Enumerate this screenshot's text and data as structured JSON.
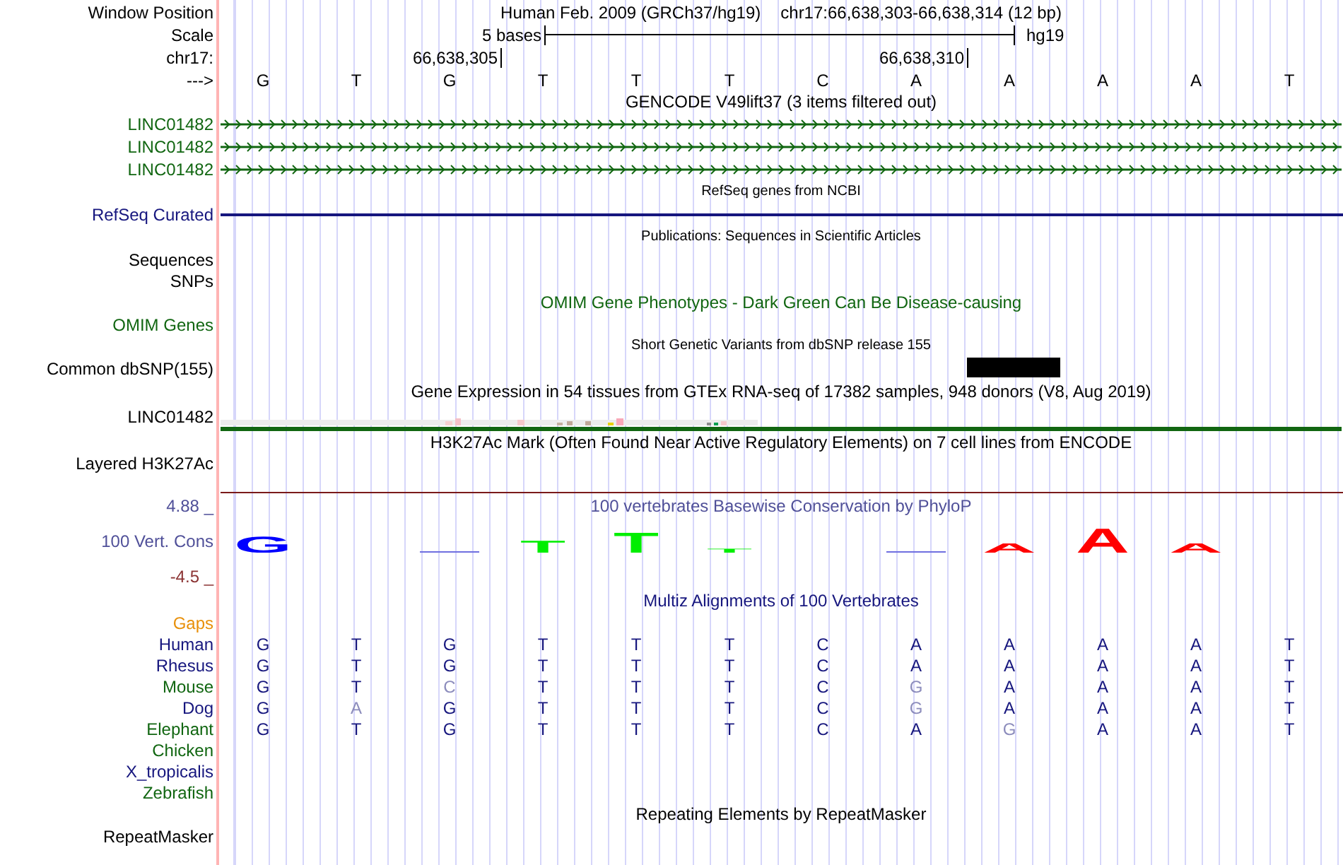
{
  "tracks": [
    {
      "kind": "position",
      "label": "Window Position",
      "text": "Human Feb. 2009 (GRCh37/hg19)",
      "range": "chr17:66,638,303-66,638,314 (12 bp)"
    },
    {
      "kind": "scale",
      "label": "Scale",
      "scale_text": "5 bases",
      "assembly": "hg19"
    },
    {
      "kind": "coords",
      "label": "chr17:",
      "ticks": [
        "66,638,305",
        "66,638,310"
      ]
    },
    {
      "kind": "sequence",
      "label": "--->",
      "bases": [
        "G",
        "T",
        "G",
        "T",
        "T",
        "T",
        "C",
        "A",
        "A",
        "A",
        "A",
        "T"
      ]
    },
    {
      "kind": "title",
      "text": "GENCODE V49lift37 (3 items filtered out)",
      "color": "#000000"
    },
    {
      "kind": "gene",
      "label": "LINC01482",
      "color": "#116611"
    },
    {
      "kind": "gene",
      "label": "LINC01482",
      "color": "#116611"
    },
    {
      "kind": "gene",
      "label": "LINC01482",
      "color": "#116611"
    },
    {
      "kind": "subtitle",
      "text": "RefSeq genes from NCBI"
    },
    {
      "kind": "line",
      "label": "RefSeq Curated",
      "color": "#16167e"
    },
    {
      "kind": "subtitle",
      "text": "Publications: Sequences in Scientific Articles"
    },
    {
      "kind": "empty",
      "label": "Sequences",
      "color": "#000000"
    },
    {
      "kind": "empty",
      "label": "SNPs",
      "color": "#000000"
    },
    {
      "kind": "title",
      "text": "OMIM Gene Phenotypes - Dark Green Can Be Disease-causing",
      "color": "#116611"
    },
    {
      "kind": "empty",
      "label": "OMIM Genes",
      "color": "#116611"
    },
    {
      "kind": "subtitle",
      "text": "Short Genetic Variants from dbSNP release 155"
    },
    {
      "kind": "snp",
      "label": "Common dbSNP(155)"
    },
    {
      "kind": "title",
      "text": "Gene Expression in 54 tissues from GTEx RNA-seq of 17382 samples, 948 donors (V8, Aug 2019)",
      "color": "#000000"
    },
    {
      "kind": "expression",
      "label": "LINC01482"
    },
    {
      "kind": "title",
      "text": "H3K27Ac Mark (Often Found Near Active Regulatory Elements) on 7 cell lines from ENCODE",
      "color": "#000000"
    },
    {
      "kind": "layered",
      "label": "Layered H3K27Ac"
    },
    {
      "kind": "scale_max",
      "label": "4.88 _",
      "text": "100 vertebrates Basewise Conservation by PhyloP",
      "color": "#505099"
    },
    {
      "kind": "logo",
      "label": "100 Vert. Cons",
      "color": "#505099",
      "logo": [
        {
          "kind": "letter",
          "base": "G",
          "color": "#0000ff"
        },
        {
          "kind": "blank"
        },
        {
          "kind": "flat",
          "color": "#6f6fe0"
        },
        {
          "kind": "letter",
          "base": "T",
          "color": "#00ee00"
        },
        {
          "kind": "letter",
          "base": "T",
          "color": "#00ee00"
        },
        {
          "kind": "letter",
          "base": "T",
          "color": "#00ee00"
        },
        {
          "kind": "blank"
        },
        {
          "kind": "flat",
          "color": "#6f6fe0"
        },
        {
          "kind": "letter",
          "base": "A",
          "color": "#ff0000"
        },
        {
          "kind": "letter",
          "base": "A",
          "color": "#ff0000"
        },
        {
          "kind": "letter",
          "base": "A",
          "color": "#ff0000"
        },
        {
          "kind": "blank"
        }
      ]
    },
    {
      "kind": "scale_min",
      "label": "-4.5 _",
      "color": "#8b3333"
    },
    {
      "kind": "title",
      "text": "Multiz Alignments of 100 Vertebrates",
      "color": "#16167e"
    },
    {
      "kind": "empty",
      "label": "Gaps",
      "color": "#e8900a"
    },
    {
      "kind": "alignment",
      "label": "Human",
      "color": "#16167e",
      "bases": [
        {
          "base": "G",
          "match": true
        },
        {
          "base": "T",
          "match": true
        },
        {
          "base": "G",
          "match": true
        },
        {
          "base": "T",
          "match": true
        },
        {
          "base": "T",
          "match": true
        },
        {
          "base": "T",
          "match": true
        },
        {
          "base": "C",
          "match": true
        },
        {
          "base": "A",
          "match": true
        },
        {
          "base": "A",
          "match": true
        },
        {
          "base": "A",
          "match": true
        },
        {
          "base": "A",
          "match": true
        },
        {
          "base": "T",
          "match": true
        }
      ]
    },
    {
      "kind": "alignment",
      "label": "Rhesus",
      "color": "#16167e",
      "bases": [
        {
          "base": "G",
          "match": true
        },
        {
          "base": "T",
          "match": true
        },
        {
          "base": "G",
          "match": true
        },
        {
          "base": "T",
          "match": true
        },
        {
          "base": "T",
          "match": true
        },
        {
          "base": "T",
          "match": true
        },
        {
          "base": "C",
          "match": true
        },
        {
          "base": "A",
          "match": true
        },
        {
          "base": "A",
          "match": true
        },
        {
          "base": "A",
          "match": true
        },
        {
          "base": "A",
          "match": true
        },
        {
          "base": "T",
          "match": true
        }
      ]
    },
    {
      "kind": "alignment",
      "label": "Mouse",
      "color": "#116611",
      "bases": [
        {
          "base": "G",
          "match": true
        },
        {
          "base": "T",
          "match": true
        },
        {
          "base": "C",
          "match": false
        },
        {
          "base": "T",
          "match": true
        },
        {
          "base": "T",
          "match": true
        },
        {
          "base": "T",
          "match": true
        },
        {
          "base": "C",
          "match": true
        },
        {
          "base": "G",
          "match": false
        },
        {
          "base": "A",
          "match": true
        },
        {
          "base": "A",
          "match": true
        },
        {
          "base": "A",
          "match": true
        },
        {
          "base": "T",
          "match": true
        }
      ]
    },
    {
      "kind": "alignment",
      "label": "Dog",
      "color": "#16167e",
      "bases": [
        {
          "base": "G",
          "match": true
        },
        {
          "base": "A",
          "match": false
        },
        {
          "base": "G",
          "match": true
        },
        {
          "base": "T",
          "match": true
        },
        {
          "base": "T",
          "match": true
        },
        {
          "base": "T",
          "match": true
        },
        {
          "base": "C",
          "match": true
        },
        {
          "base": "G",
          "match": false
        },
        {
          "base": "A",
          "match": true
        },
        {
          "base": "A",
          "match": true
        },
        {
          "base": "A",
          "match": true
        },
        {
          "base": "T",
          "match": true
        }
      ]
    },
    {
      "kind": "alignment",
      "label": "Elephant",
      "color": "#116611",
      "bases": [
        {
          "base": "G",
          "match": true
        },
        {
          "base": "T",
          "match": true
        },
        {
          "base": "G",
          "match": true
        },
        {
          "base": "T",
          "match": true
        },
        {
          "base": "T",
          "match": true
        },
        {
          "base": "T",
          "match": true
        },
        {
          "base": "C",
          "match": true
        },
        {
          "base": "A",
          "match": true
        },
        {
          "base": "G",
          "match": false
        },
        {
          "base": "A",
          "match": true
        },
        {
          "base": "A",
          "match": true
        },
        {
          "base": "T",
          "match": true
        }
      ]
    },
    {
      "kind": "empty",
      "label": "Chicken",
      "color": "#116611"
    },
    {
      "kind": "empty",
      "label": "X_tropicalis",
      "color": "#16167e"
    },
    {
      "kind": "empty",
      "label": "Zebrafish",
      "color": "#116611"
    },
    {
      "kind": "title",
      "text": "Repeating Elements by RepeatMasker",
      "color": "#000000"
    },
    {
      "kind": "empty",
      "label": "RepeatMasker",
      "color": "#000000"
    }
  ]
}
